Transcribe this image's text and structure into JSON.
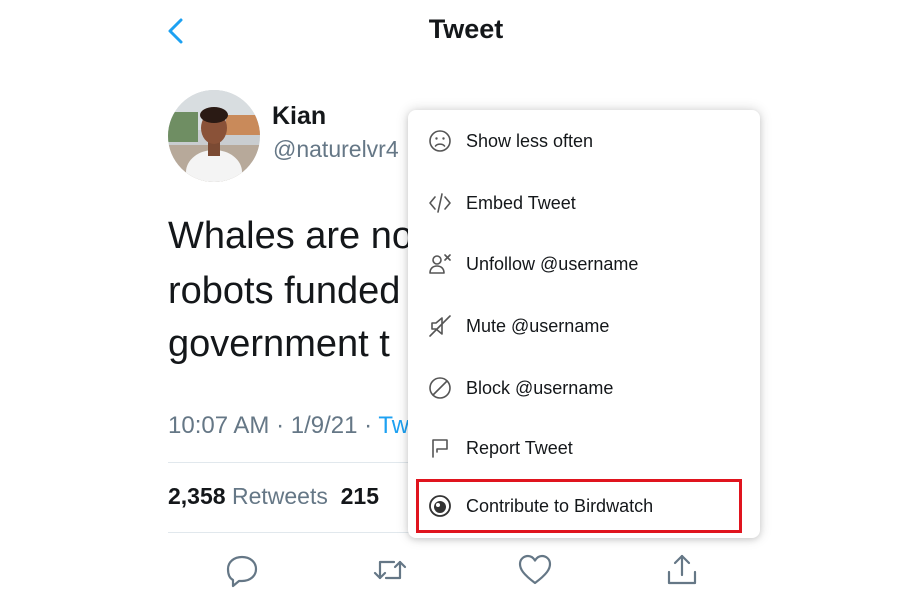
{
  "header": {
    "title": "Tweet"
  },
  "author": {
    "name": "Kian",
    "handle": "@naturelvr4"
  },
  "tweet": {
    "lines": [
      "Whales are no",
      "robots funded",
      "government t"
    ],
    "time": "10:07 AM",
    "separator": " · ",
    "date": "1/9/21",
    "source": "Tw"
  },
  "stats": {
    "retweets_count": "2,358",
    "retweets_label": "Retweets",
    "likes_count": "215"
  },
  "menu": {
    "items": [
      {
        "label": "Show less often",
        "icon": "frown-icon"
      },
      {
        "label": "Embed Tweet",
        "icon": "code-icon"
      },
      {
        "label": "Unfollow @username",
        "icon": "unfollow-icon"
      },
      {
        "label": "Mute @username",
        "icon": "mute-icon"
      },
      {
        "label": "Block @username",
        "icon": "block-icon"
      },
      {
        "label": "Report Tweet",
        "icon": "flag-icon"
      },
      {
        "label": "Contribute to Birdwatch",
        "icon": "birdwatch-icon"
      }
    ]
  },
  "colors": {
    "accent": "#1da1f2",
    "highlight": "#e0141e",
    "secondary_text": "#657786"
  }
}
